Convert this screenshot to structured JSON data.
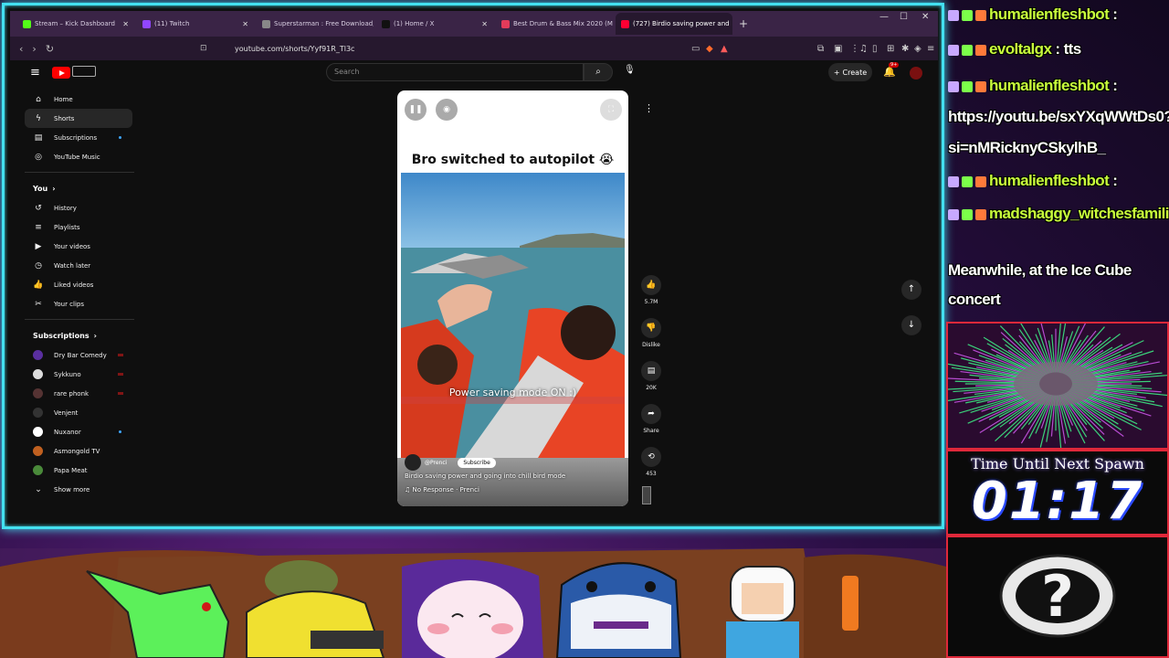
{
  "browser": {
    "tabs": [
      {
        "label": "Stream – Kick Dashboard",
        "color": "#53fc18"
      },
      {
        "label": "(11) Twitch",
        "color": "#9146ff"
      },
      {
        "label": "Superstarman : Free Download, Borro",
        "color": "#888888"
      },
      {
        "label": "(1) Home / X",
        "color": "#111111"
      },
      {
        "label": "Best Drum & Bass Mix 2020 (Mu",
        "color": "#e23b5a"
      },
      {
        "label": "(727) Birdio saving power and",
        "color": "#ff0033"
      }
    ],
    "new_tab": "+",
    "url": "youtube.com/shorts/Yyf91R_Tl3c"
  },
  "youtube": {
    "search_placeholder": "Search",
    "create_label": "Create",
    "notif_badge": "9+",
    "sidebar": {
      "main": [
        {
          "label": "Home",
          "icon": "home-icon",
          "glyph": "⌂"
        },
        {
          "label": "Shorts",
          "icon": "shorts-icon",
          "glyph": "ϟ"
        },
        {
          "label": "Subscriptions",
          "icon": "subscriptions-icon",
          "glyph": "▤"
        },
        {
          "label": "YouTube Music",
          "icon": "music-icon",
          "glyph": "◎"
        }
      ],
      "you_heading": "You",
      "you_chevron": "›",
      "you": [
        {
          "label": "History",
          "icon": "history-icon",
          "glyph": "↺"
        },
        {
          "label": "Playlists",
          "icon": "playlists-icon",
          "glyph": "≡"
        },
        {
          "label": "Your videos",
          "icon": "your-videos-icon",
          "glyph": "▶"
        },
        {
          "label": "Watch later",
          "icon": "watch-later-icon",
          "glyph": "◷"
        },
        {
          "label": "Liked videos",
          "icon": "liked-videos-icon",
          "glyph": "👍"
        },
        {
          "label": "Your clips",
          "icon": "clips-icon",
          "glyph": "✂"
        }
      ],
      "subs_heading": "Subscriptions",
      "subs_chevron": "›",
      "subs": [
        {
          "label": "Dry Bar Comedy",
          "color": "#5a2fa0"
        },
        {
          "label": "Sykkuno",
          "color": "#dddddd"
        },
        {
          "label": "rare phonk",
          "color": "#553333"
        },
        {
          "label": "Venjent",
          "color": "#333333"
        },
        {
          "label": "Nuxanor",
          "color": "#ffffff"
        },
        {
          "label": "Asmongold TV",
          "color": "#c06020"
        },
        {
          "label": "Papa Meat",
          "color": "#4a8a3a"
        }
      ],
      "show_more": "Show more"
    },
    "short": {
      "caption": "Bro switched to autopilot 😭",
      "overlay": "Power saving mode ON :)",
      "channel": "@Prenci",
      "subscribe": "Subscribe",
      "title": "Birdio saving power and going into chill bird mode",
      "music": "♫ No Response · Prenci"
    },
    "actions": {
      "likes": "5.7M",
      "dislike": "Dislike",
      "comments": "20K",
      "share": "Share",
      "remix": "453"
    }
  },
  "chat": [
    {
      "user": "humalienfleshbot",
      "text": ":"
    },
    {
      "user": "evoltalgx",
      "text": ": tts"
    },
    {
      "user": "humalienfleshbot",
      "text": ":"
    },
    {
      "user": "",
      "text": "https://youtu.be/sxYXqWWtDs0?"
    },
    {
      "user": "",
      "text": "si=nMRicknyCSkylhB_"
    },
    {
      "user": "humalienfleshbot",
      "text": ":"
    },
    {
      "user": "madshaggy_witchesfamiliar",
      "text": ":"
    },
    {
      "user": "",
      "text": "Meanwhile, at the Ice Cube"
    },
    {
      "user": "",
      "text": "concert"
    }
  ],
  "timer": {
    "label": "Time Until Next Spawn",
    "value": "01:17"
  },
  "colors": {
    "frame": "#43e0f0",
    "panel_border": "#e0283a",
    "chat_user": "#c8ff3c",
    "yt_red": "#ff0000"
  }
}
